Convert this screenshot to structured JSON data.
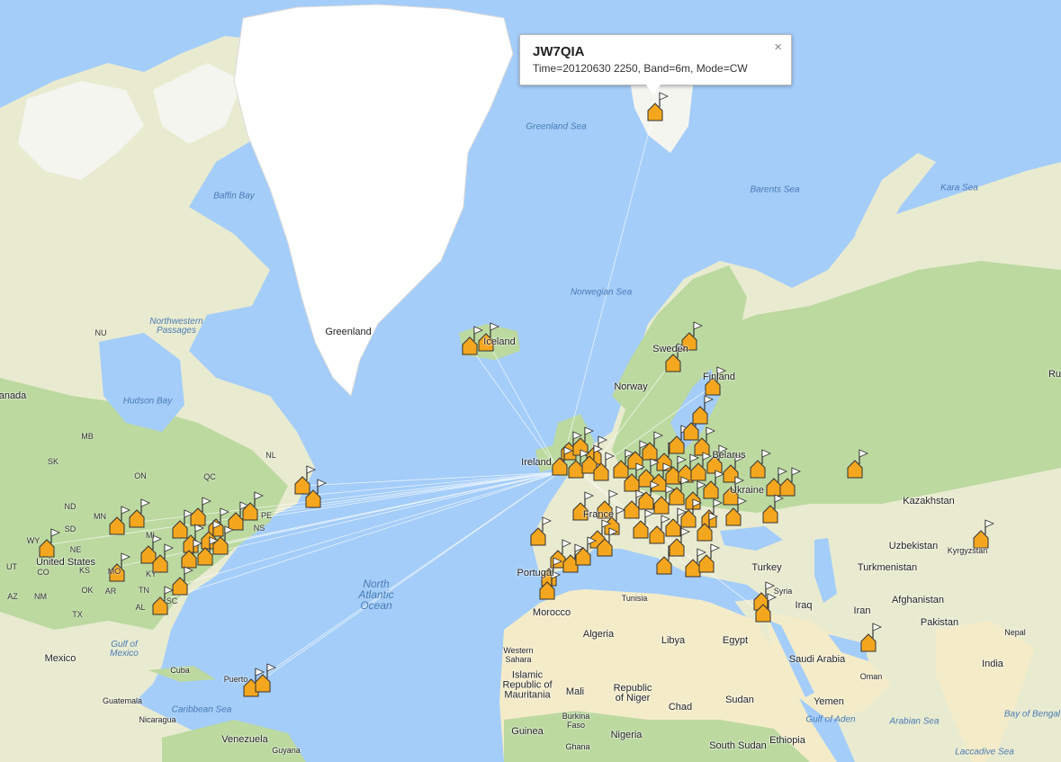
{
  "popup": {
    "callsign": "JW7QIA",
    "details": "Time=20120630 2250, Band=6m, Mode=CW",
    "close_symbol": "×"
  },
  "labels": {
    "countries": {
      "greenland": "Greenland",
      "iceland": "Iceland",
      "norway": "Norway",
      "sweden": "Sweden",
      "finland": "Finland",
      "ireland": "Ireland",
      "belarus": "Belarus",
      "ukraine": "Ukraine",
      "france": "France",
      "portugal": "Portugal",
      "kazakhstan": "Kazakhstan",
      "uzbekistan": "Uzbekistan",
      "kyrgyzstan": "Kyrgyzstan",
      "turkmenistan": "Turkmenistan",
      "afghanistan": "Afghanistan",
      "pakistan": "Pakistan",
      "iran": "Iran",
      "iraq": "Iraq",
      "syria": "Syria",
      "turkey": "Turkey",
      "greece": "Greece",
      "tunisia": "Tunisia",
      "morocco": "Morocco",
      "algeria": "Algeria",
      "libya": "Libya",
      "egypt": "Egypt",
      "saudi_arabia": "Saudi Arabia",
      "oman": "Oman",
      "yemen": "Yemen",
      "nepal": "Nepal",
      "india": "India",
      "western_sahara": "Western\nSahara",
      "mauritania": "Islamic\nRepublic of\nMauritania",
      "mali": "Mali",
      "niger": "Republic\nof Niger",
      "chad": "Chad",
      "sudan": "Sudan",
      "south_sudan": "South Sudan",
      "ethiopia": "Ethiopia",
      "nigeria": "Nigeria",
      "guinea": "Guinea",
      "ghana": "Ghana",
      "burkina_faso": "Burkina\nFaso",
      "canada": "anada",
      "united_states": "United States",
      "mexico": "Mexico",
      "cuba": "Cuba",
      "puerto_rico": "Puerto",
      "guatemala": "Guatemala",
      "nicaragua": "Nicaragua",
      "venezuela": "Venezuela",
      "guyana": "Guyana",
      "russia": "Ru"
    },
    "states": {
      "nu": "NU",
      "qc": "QC",
      "on": "ON",
      "mb": "MB",
      "sk": "SK",
      "nl": "NL",
      "ns": "NS",
      "pe": "PE",
      "mn": "MN",
      "nd": "ND",
      "sd": "SD",
      "wy": "WY",
      "ne": "NE",
      "ks": "KS",
      "ut": "UT",
      "co": "CO",
      "az": "AZ",
      "nm": "NM",
      "ok": "OK",
      "tx": "TX",
      "ar": "AR",
      "al": "AL",
      "mo": "MO",
      "ky": "KY",
      "tn": "TN",
      "sc": "SC",
      "mi": "MI"
    },
    "water": {
      "baffin_bay": "Baffin Bay",
      "hudson_bay": "Hudson Bay",
      "northwest_passages": "Northwestern\nPassages",
      "greenland_sea": "Greenland Sea",
      "norwegian_sea": "Norwegian Sea",
      "barents_sea": "Barents Sea",
      "kara_sea": "Kara Sea",
      "gulf_of_mexico": "Gulf of\nMexico",
      "caribbean_sea": "Caribbean Sea",
      "gulf_of_aden": "Gulf of Aden",
      "arabian_sea": "Arabian Sea",
      "bay_of_bengal": "Bay of Bengal",
      "laccadive_sea": "Laccadive Sea",
      "north_atlantic": "North\nAtlantic\nOcean"
    }
  },
  "colors": {
    "ocean": "#a4cdf9",
    "land": "#e9ebd0",
    "land_green": "#bcd9a0",
    "ice": "#ffffff",
    "desert": "#f4ecc9",
    "marker": "#f4a71e",
    "path": "#ffffff"
  },
  "marker_icon": "house-flag-marker-icon",
  "contact_count": "many"
}
